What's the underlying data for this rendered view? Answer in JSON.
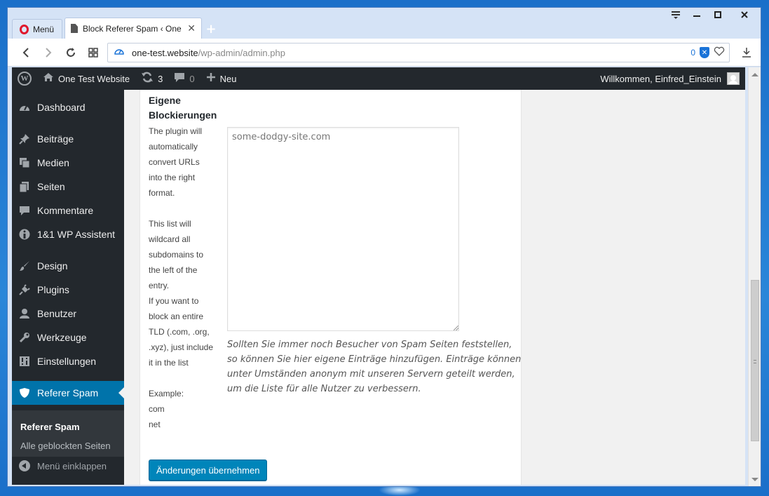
{
  "browser": {
    "menu_label": "Menü",
    "active_tab_title": "Block Referer Spam ‹ One",
    "url_host": "one-test.website",
    "url_path": "/wp-admin/admin.php",
    "adblock_count": "0"
  },
  "adminbar": {
    "site_name": "One Test Website",
    "updates_count": "3",
    "comments_count": "0",
    "new_label": "Neu",
    "greeting": "Willkommen, Einfred_Einstein"
  },
  "sidebar": {
    "items": [
      {
        "label": "Dashboard",
        "icon": "dashboard-icon"
      },
      {
        "label": "Beiträge",
        "icon": "pin-icon"
      },
      {
        "label": "Medien",
        "icon": "media-icon"
      },
      {
        "label": "Seiten",
        "icon": "pages-icon"
      },
      {
        "label": "Kommentare",
        "icon": "comment-icon"
      },
      {
        "label": "1&1 WP Assistent",
        "icon": "info-icon"
      },
      {
        "label": "Design",
        "icon": "brush-icon"
      },
      {
        "label": "Plugins",
        "icon": "plugin-icon"
      },
      {
        "label": "Benutzer",
        "icon": "user-icon"
      },
      {
        "label": "Werkzeuge",
        "icon": "wrench-icon"
      },
      {
        "label": "Einstellungen",
        "icon": "settings-icon"
      },
      {
        "label": "Referer Spam",
        "icon": "shield-icon"
      }
    ],
    "submenu": {
      "active": "Referer Spam",
      "other": "Alle geblockten Seiten"
    },
    "collapse_label": "Menü einklappen"
  },
  "form": {
    "field_label": "Eigene Blockierungen",
    "help_lines_1": [
      "The plugin will",
      "automatically",
      "convert URLs",
      "into the right",
      "format."
    ],
    "help_lines_2": [
      "This list will",
      "wildcard all",
      "subdomains to",
      "the left of the",
      "entry."
    ],
    "help_lines_3": [
      "If you want to",
      "block an entire",
      "TLD (.com, .org,",
      ".xyz), just include",
      "it in the list"
    ],
    "help_lines_4": [
      "Example:",
      "com",
      "net"
    ],
    "textarea_value": "some-dodgy-site.com",
    "description": "Sollten Sie immer noch Besucher von Spam Seiten feststellen, so können Sie hier eigene Einträge hinzufügen. Einträge können unter Umständen anonym mit unseren Servern geteilt werden, um die Liste für alle Nutzer zu verbessern.",
    "submit_label": "Änderungen übernehmen"
  },
  "colors": {
    "wp_admin_dark": "#23282d",
    "wp_accent": "#0073aa",
    "button": "#0085ba"
  }
}
